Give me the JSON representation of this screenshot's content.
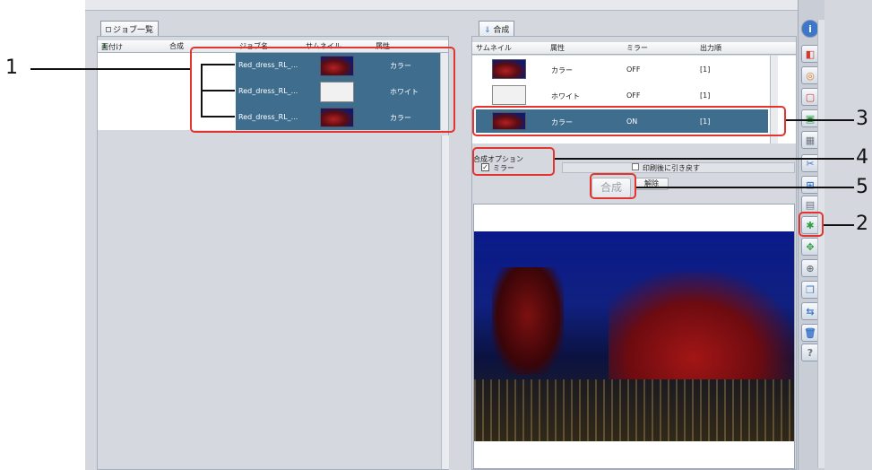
{
  "left_panel": {
    "tab_label": "ジョブ一覧",
    "columns": [
      "面付け",
      "合成",
      "ジョブ名",
      "サムネイル",
      "属性"
    ],
    "rows": [
      {
        "job": "Red_dress_RL_...",
        "attr": "カラー",
        "thumb": "dark"
      },
      {
        "job": "Red_dress_RL_...",
        "attr": "ホワイト",
        "thumb": "white"
      },
      {
        "job": "Red_dress_RL_...",
        "attr": "カラー",
        "thumb": "dark"
      }
    ]
  },
  "right_panel": {
    "tab_label": "合成",
    "columns": [
      "サムネイル",
      "属性",
      "ミラー",
      "出力順"
    ],
    "rows": [
      {
        "attr": "カラー",
        "mirror": "OFF",
        "order": "[1]",
        "thumb": "dark",
        "selected": false
      },
      {
        "attr": "ホワイト",
        "mirror": "OFF",
        "order": "[1]",
        "thumb": "white",
        "selected": false
      },
      {
        "attr": "カラー",
        "mirror": "ON",
        "order": "[1]",
        "thumb": "dark",
        "selected": true
      }
    ],
    "options_title": "合成オプション",
    "mirror_label": "ミラー",
    "mirror_checked": true,
    "print_back_label": "印刷後に引き戻す",
    "compose_button": "合成",
    "cancel_button": "解除"
  },
  "callouts": [
    "1",
    "2",
    "3",
    "4",
    "5"
  ],
  "colors": {
    "selection": "#3e6d8e",
    "callout": "#e3342f",
    "accent_green": "#2ea043"
  }
}
